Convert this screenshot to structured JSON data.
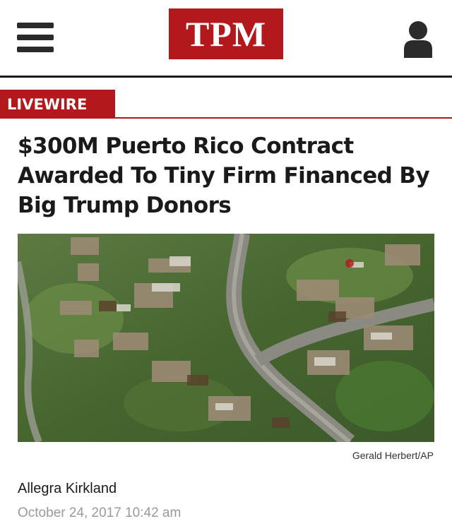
{
  "header": {
    "logo_text": "TPM",
    "menu_icon": "hamburger-menu-icon",
    "user_icon": "user-account-icon",
    "brand_color": "#b3191c"
  },
  "article": {
    "section": "LIVEWIRE",
    "headline": "$300M Puerto Rico Contract Awarded To Tiny Firm Financed By Big Trump Donors",
    "photo_credit": "Gerald Herbert/AP",
    "author": "Allegra Kirkland",
    "date": "October 24, 2017 10:42 am"
  }
}
